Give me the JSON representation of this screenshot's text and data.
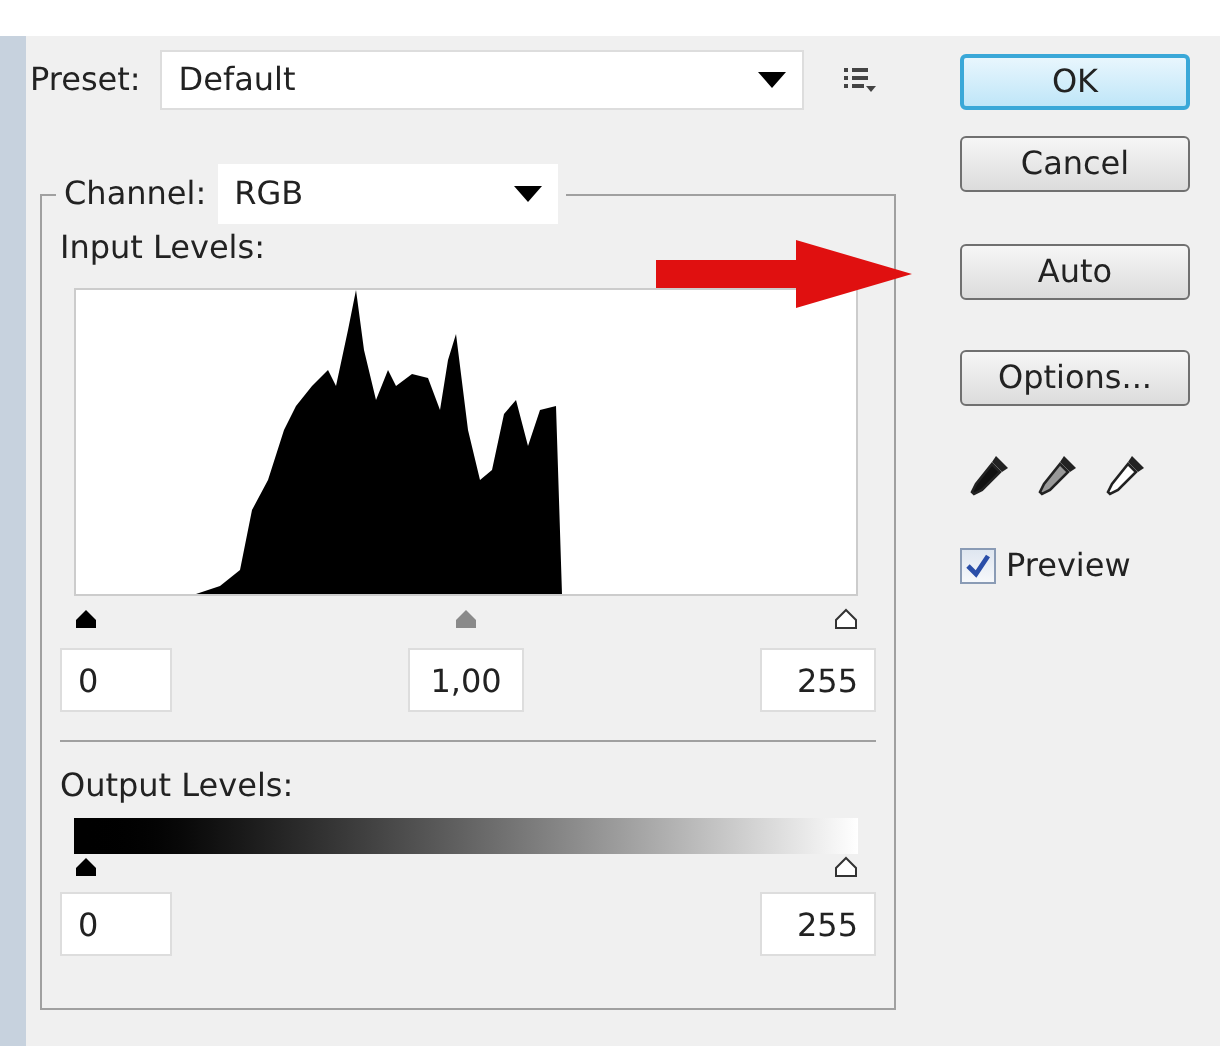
{
  "preset": {
    "label": "Preset:",
    "value": "Default"
  },
  "channel": {
    "label": "Channel:",
    "value": "RGB"
  },
  "input_levels": {
    "label": "Input Levels:",
    "sliders": [
      {
        "kind": "black",
        "level": 0
      },
      {
        "kind": "gray",
        "level": 0.5
      },
      {
        "kind": "white",
        "level": 1
      }
    ],
    "fields": [
      "0",
      "1,00",
      "255"
    ]
  },
  "output_levels": {
    "label": "Output Levels:",
    "sliders": [
      {
        "kind": "black",
        "level": 0
      },
      {
        "kind": "white",
        "level": 1
      }
    ],
    "fields": [
      "0",
      "255"
    ]
  },
  "buttons": [
    {
      "label": "OK",
      "kind": "default"
    },
    {
      "label": "Cancel",
      "kind": "normal"
    },
    {
      "label": "Auto",
      "kind": "normal"
    },
    {
      "label": "Options...",
      "kind": "normal"
    }
  ],
  "eyedroppers": [
    {
      "kind": "black"
    },
    {
      "kind": "gray"
    },
    {
      "kind": "white"
    }
  ],
  "preview": {
    "label": "Preview",
    "checked": true
  }
}
